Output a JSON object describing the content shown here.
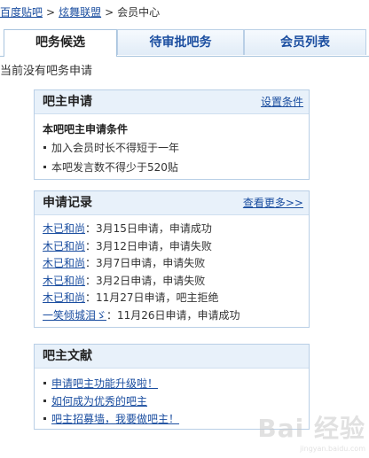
{
  "breadcrumb": {
    "home": "百度贴吧",
    "forum": "炫舞联盟",
    "current": "会员中心",
    "separator": ">"
  },
  "tabs": [
    {
      "label": "吧务候选"
    },
    {
      "label": "待审批吧务"
    },
    {
      "label": "会员列表"
    }
  ],
  "notice": "当前没有吧务申请",
  "apply_panel": {
    "title": "吧主申请",
    "link": "设置条件",
    "conditions_title": "本吧吧主申请条件",
    "conditions": [
      "加入会员时长不得短于一年",
      "本吧发言数不得少于520贴"
    ]
  },
  "records_panel": {
    "title": "申请记录",
    "link": "查看更多>>",
    "records": [
      {
        "user": "木已和尚",
        "text": "：3月15日申请，申请成功"
      },
      {
        "user": "木已和尚",
        "text": "：3月12日申请，申请失败"
      },
      {
        "user": "木已和尚",
        "text": "：3月7日申请，申请失败"
      },
      {
        "user": "木已和尚",
        "text": "：3月2日申请，申请失败"
      },
      {
        "user": "木已和尚",
        "text": "：11月27日申请，吧主拒绝"
      },
      {
        "user": "一笑倾城泪ゞ",
        "text": "：11月26日申请，申请成功"
      }
    ]
  },
  "docs_panel": {
    "title": "吧主文献",
    "links": [
      "申请吧主功能升级啦！",
      "如何成为优秀的吧主",
      "吧主招募墙，我要做吧主！"
    ]
  },
  "watermark": {
    "text": "Bai 经验",
    "sub": "jingyan.baidu.com"
  }
}
